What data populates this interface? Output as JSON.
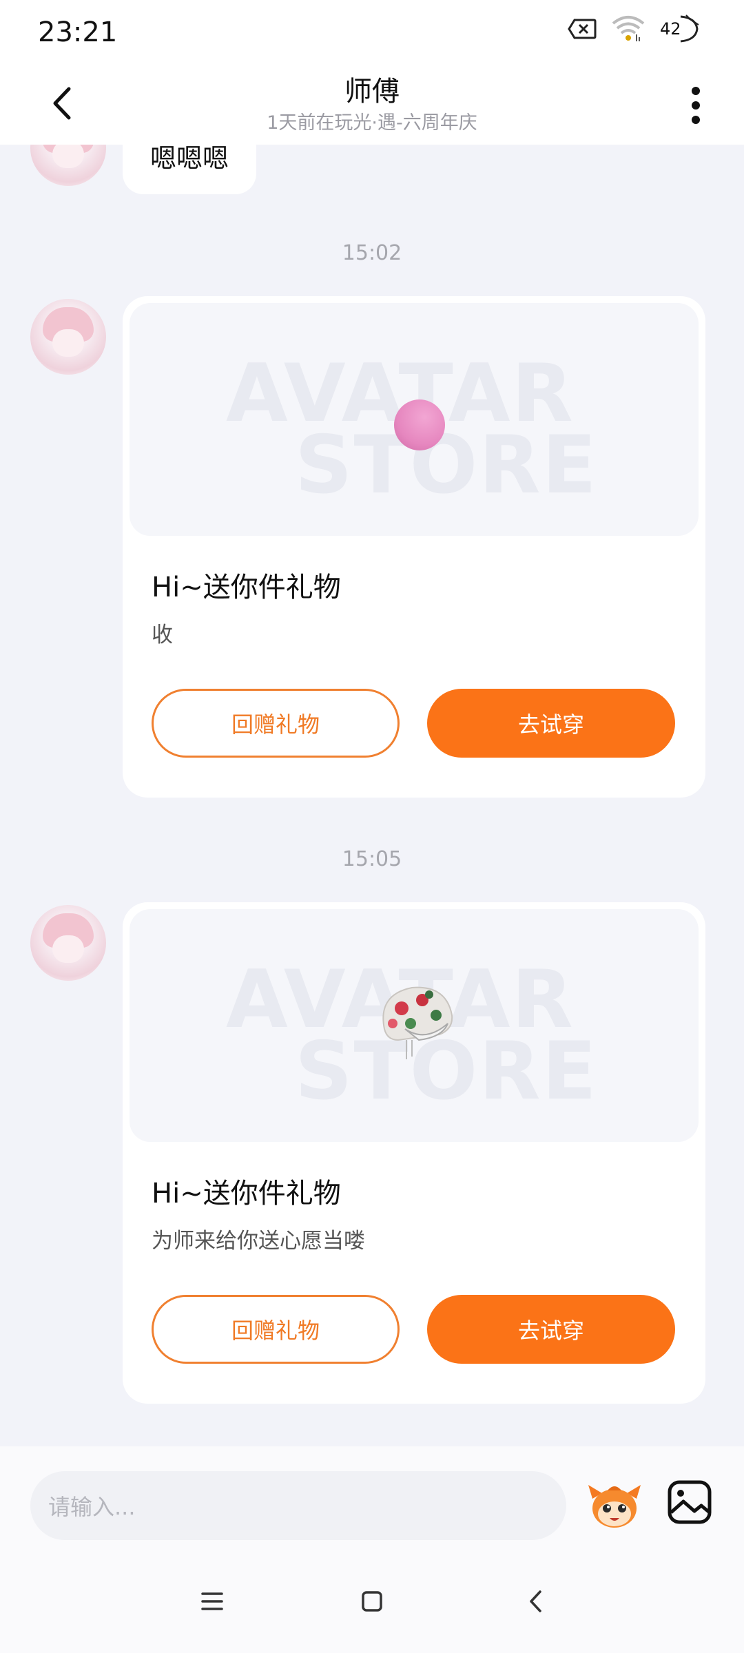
{
  "status_bar": {
    "time": "23:21",
    "battery_level": "42",
    "icons": [
      "sim-x-icon",
      "wifi-icon",
      "battery-icon"
    ]
  },
  "header": {
    "title": "师傅",
    "subtitle": "1天前在玩光·遇-六周年庆"
  },
  "messages": {
    "text_bubble": "嗯嗯嗯",
    "time_1": "15:02",
    "gift_1": {
      "title": "Hi~送你件礼物",
      "message": "收",
      "return_label": "回赠礼物",
      "try_label": "去试穿",
      "watermark_1": "AVATAR",
      "watermark_2": "STORE"
    },
    "time_2": "15:05",
    "gift_2": {
      "title": "Hi~送你件礼物",
      "message": "为师来给你送心愿当喽",
      "return_label": "回赠礼物",
      "try_label": "去试穿",
      "watermark_1": "AVATAR",
      "watermark_2": "STORE"
    }
  },
  "input": {
    "placeholder": "请输入..."
  },
  "colors": {
    "accent": "#fb7317",
    "background": "#f2f3f9"
  }
}
